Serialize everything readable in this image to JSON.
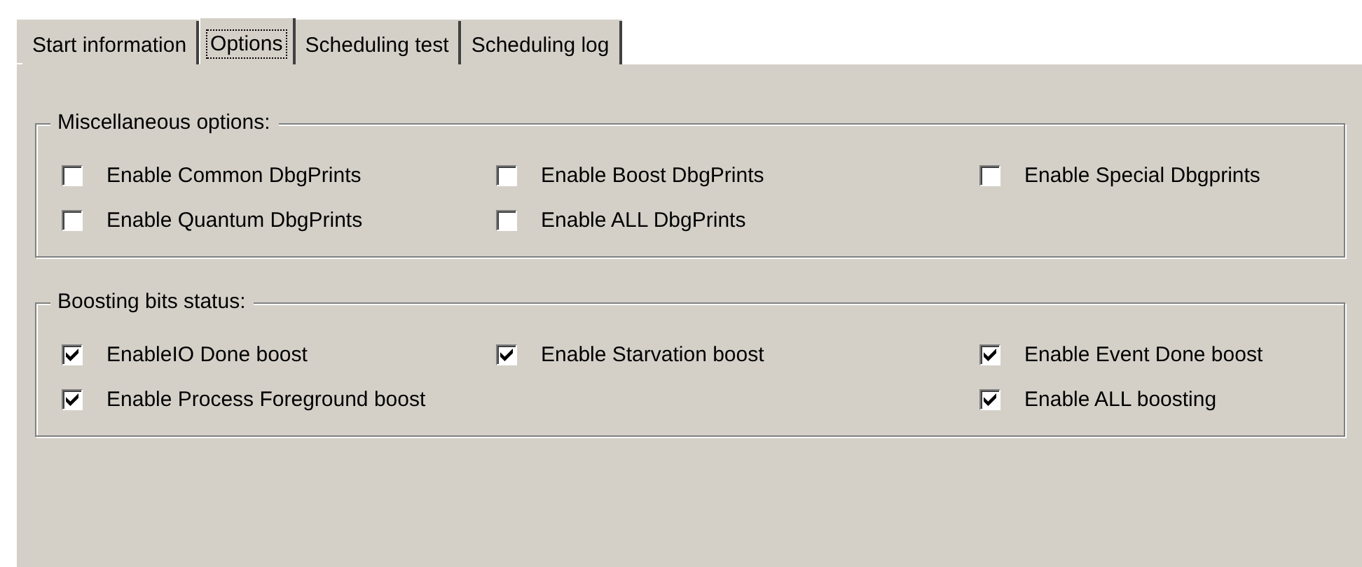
{
  "tabs": [
    {
      "label": "Start information",
      "selected": false
    },
    {
      "label": "Options",
      "selected": true
    },
    {
      "label": "Scheduling test",
      "selected": false
    },
    {
      "label": "Scheduling log",
      "selected": false
    }
  ],
  "groups": [
    {
      "title": "Miscellaneous options:",
      "columns": [
        [
          {
            "label": "Enable Common DbgPrints",
            "checked": false
          },
          {
            "label": "Enable Quantum DbgPrints",
            "checked": false
          }
        ],
        [
          {
            "label": "Enable Boost DbgPrints",
            "checked": false
          },
          {
            "label": "Enable ALL DbgPrints",
            "checked": false
          }
        ],
        [
          {
            "label": "Enable Special Dbgprints",
            "checked": false
          }
        ]
      ]
    },
    {
      "title": "Boosting bits status:",
      "columns": [
        [
          {
            "label": "EnableIO Done boost",
            "checked": true
          },
          {
            "label": "Enable Process Foreground boost",
            "checked": true
          }
        ],
        [
          {
            "label": "Enable Starvation boost",
            "checked": true
          }
        ],
        [
          {
            "label": "Enable Event Done boost",
            "checked": true
          },
          {
            "label": "Enable ALL boosting",
            "checked": true
          }
        ]
      ]
    }
  ]
}
